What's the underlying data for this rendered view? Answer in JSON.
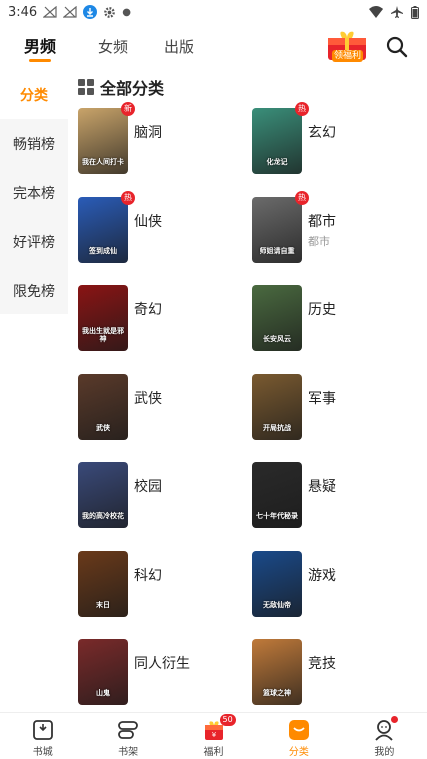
{
  "status": {
    "time": "3:46"
  },
  "header": {
    "tabs": [
      "男频",
      "女频",
      "出版"
    ],
    "welfare_label": "领福利"
  },
  "sidebar": {
    "items": [
      "分类",
      "畅销榜",
      "完本榜",
      "好评榜",
      "限免榜"
    ]
  },
  "section": {
    "title": "全部分类"
  },
  "categories": [
    {
      "name": "脑洞",
      "tag": "新",
      "cover_text": "我在人间打卡",
      "cover_color": "#c9a46a"
    },
    {
      "name": "玄幻",
      "tag": "热",
      "cover_text": "化龙记",
      "cover_color": "#3a8f7a"
    },
    {
      "name": "仙侠",
      "tag": "热",
      "cover_text": "签到成仙",
      "cover_color": "#2a5cb8"
    },
    {
      "name": "都市",
      "tag": "热",
      "sub": "都市",
      "cover_text": "师姐请自重",
      "cover_color": "#6b6b6b"
    },
    {
      "name": "奇幻",
      "cover_text": "我出生就是邪神",
      "cover_color": "#8a1414"
    },
    {
      "name": "历史",
      "cover_text": "长安风云",
      "cover_color": "#4a6a40"
    },
    {
      "name": "武侠",
      "cover_text": "武侠",
      "cover_color": "#5a3a2a"
    },
    {
      "name": "军事",
      "cover_text": "开局抗战",
      "cover_color": "#7a5a30"
    },
    {
      "name": "校园",
      "cover_text": "我的高冷校花",
      "cover_color": "#3a4a7a"
    },
    {
      "name": "悬疑",
      "cover_text": "七十年代秘录",
      "cover_color": "#2a2a2a"
    },
    {
      "name": "科幻",
      "cover_text": "末日",
      "cover_color": "#6a3a1a"
    },
    {
      "name": "游戏",
      "cover_text": "无敌仙帝",
      "cover_color": "#1a4a8a"
    },
    {
      "name": "同人衍生",
      "cover_text": "山鬼",
      "cover_color": "#7a2a2a"
    },
    {
      "name": "竞技",
      "cover_text": "篮球之神",
      "cover_color": "#c07a3a"
    }
  ],
  "bottom_nav": {
    "items": [
      {
        "label": "书城",
        "icon": "book-icon"
      },
      {
        "label": "书架",
        "icon": "shelf-icon"
      },
      {
        "label": "福利",
        "icon": "gift-icon",
        "badge": "50"
      },
      {
        "label": "分类",
        "icon": "category-icon"
      },
      {
        "label": "我的",
        "icon": "profile-icon"
      }
    ]
  },
  "colors": {
    "accent": "#ff8a00",
    "tag": "#e8242b"
  }
}
